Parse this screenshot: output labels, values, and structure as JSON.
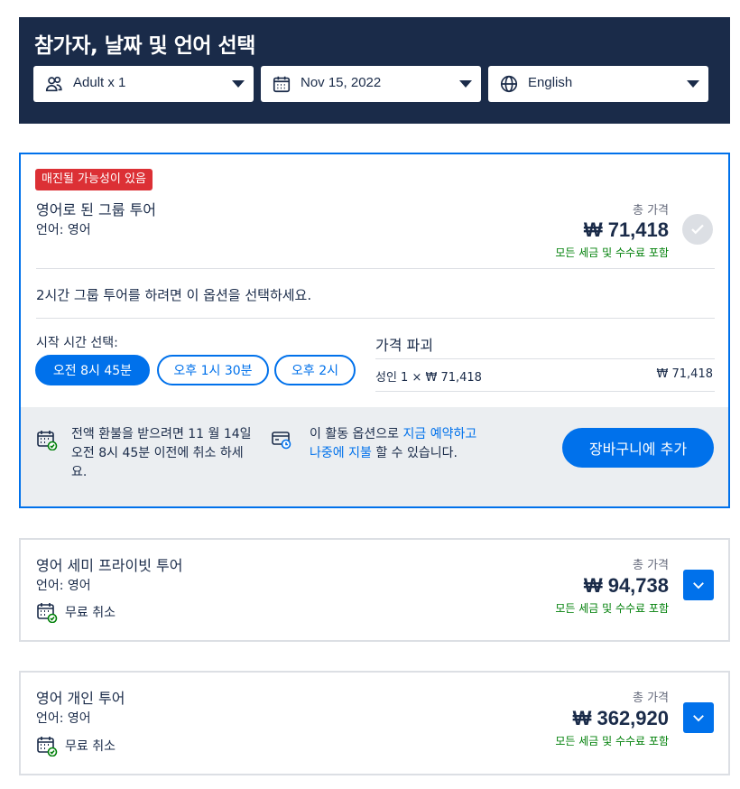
{
  "header": {
    "title": "참가자, 날짜 및 언어 선택",
    "participants": "Adult x 1",
    "date": "Nov 15, 2022",
    "language": "English"
  },
  "options": [
    {
      "badge": "매진될 가능성이 있음",
      "title": "영어로 된 그룹 투어",
      "language": "언어: 영어",
      "price_label": "총 가격",
      "price": "₩ 71,418",
      "tax_note": "모든 세금 및 수수료 포함",
      "description": "2시간 그룹 투어를 하려면 이 옵션을 선택하세요.",
      "start_time_label": "시작 시간 선택:",
      "times": [
        "오전 8시 45분",
        "오후 1시 30분",
        "오후 2시"
      ],
      "breakdown_title": "가격 파괴",
      "breakdown_item": "성인 1 × ₩ 71,418",
      "breakdown_total": "₩ 71,418",
      "refund_text": "전액 환불을 받으려면 11 월 14일 오전 8시 45분 이전에 취소 하세요.",
      "pay_text_1": "이 활동 옵션으로 ",
      "pay_link": "지금 예약하고 나중에 지불",
      "pay_text_2": "할 수 있습니다.",
      "cart_button": "장바구니에 추가"
    },
    {
      "title": "영어 세미 프라이빗 투어",
      "language": "언어: 영어",
      "free_cancel": "무료 취소",
      "price_label": "총 가격",
      "price": "₩ 94,738",
      "tax_note": "모든 세금 및 수수료 포함"
    },
    {
      "title": "영어 개인 투어",
      "language": "언어: 영어",
      "free_cancel": "무료 취소",
      "price_label": "총 가격",
      "price": "₩ 362,920",
      "tax_note": "모든 세금 및 수수료 포함"
    }
  ],
  "colors": {
    "header_bg": "#1a2b49",
    "accent": "#0071eb",
    "badge": "#dc3035",
    "tax_green": "#008009"
  }
}
